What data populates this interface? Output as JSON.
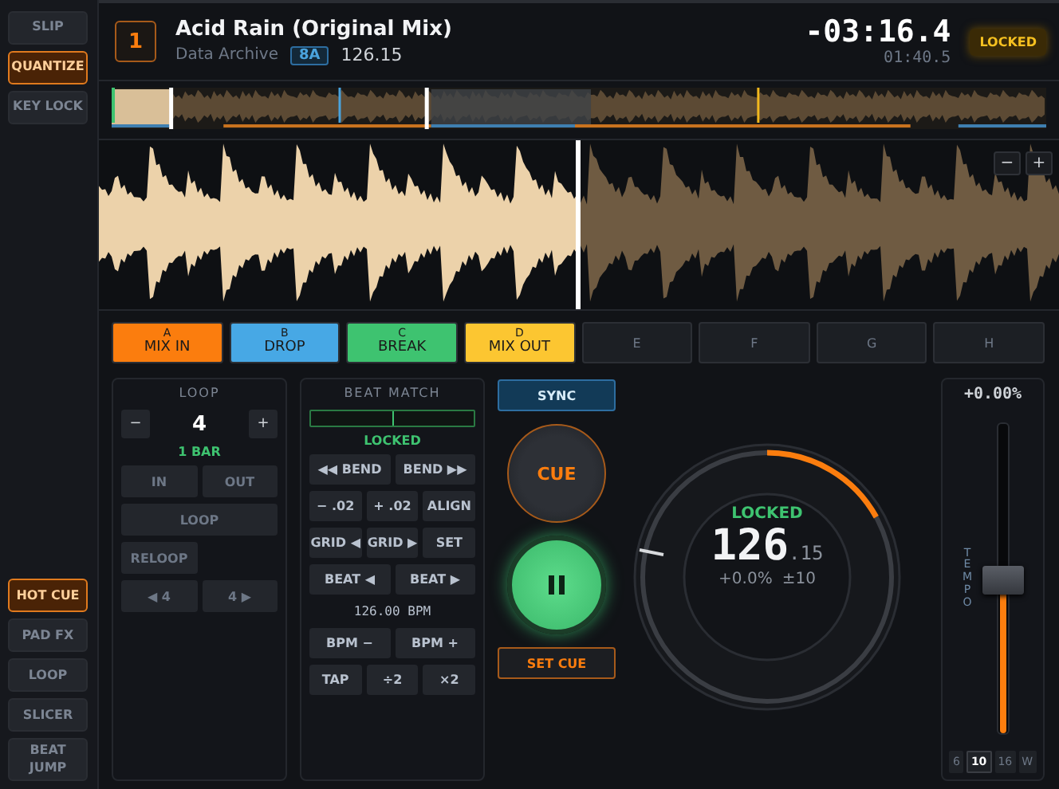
{
  "sidebar": {
    "top_buttons": [
      {
        "label": "SLIP",
        "on": false
      },
      {
        "label": "QUANTIZE",
        "on": true
      },
      {
        "label": "KEY LOCK",
        "on": false
      }
    ],
    "mode_buttons": [
      {
        "label": "HOT CUE",
        "selected": true
      },
      {
        "label": "PAD FX",
        "selected": false
      },
      {
        "label": "LOOP",
        "selected": false
      },
      {
        "label": "SLICER",
        "selected": false
      },
      {
        "label": "BEAT JUMP",
        "selected": false
      }
    ]
  },
  "deck": {
    "number": "1",
    "title": "Acid Rain (Original Mix)",
    "artist": "Data Archive",
    "key": "8A",
    "bpm": "126.15",
    "remaining": "-03:16.4",
    "elapsed": "01:40.5",
    "sync_badge": "LOCKED"
  },
  "waveform": {
    "zoom_buttons": [
      "−",
      "+"
    ]
  },
  "hot_cues": [
    {
      "letter": "A",
      "label": "MIX IN",
      "color": "#fb7d0e"
    },
    {
      "letter": "B",
      "label": "DROP",
      "color": "#47a8e5"
    },
    {
      "letter": "C",
      "label": "BREAK",
      "color": "#3ec370"
    },
    {
      "letter": "D",
      "label": "MIX OUT",
      "color": "#fcc631"
    },
    {
      "letter": "E"
    },
    {
      "letter": "F"
    },
    {
      "letter": "G"
    },
    {
      "letter": "H"
    }
  ],
  "loop": {
    "title": "LOOP",
    "minus": "−",
    "size": "4",
    "plus": "+",
    "length": "1 BAR",
    "in": "IN",
    "out": "OUT",
    "loop": "LOOP",
    "reloop": "RELOOP",
    "back": "◀ 4",
    "forward": "4 ▶"
  },
  "beat_match": {
    "title": "BEAT MATCH",
    "level": 0.5,
    "status": "LOCKED",
    "rows": [
      [
        "◀◀ BEND",
        "BEND ▶▶"
      ],
      [
        "− .02",
        "+ .02",
        "ALIGN"
      ],
      [
        "GRID ◀",
        "GRID ▶",
        "SET"
      ],
      [
        "BEAT ◀",
        "BEAT ▶"
      ]
    ],
    "bpm_readout": "126.00 BPM",
    "rows2": [
      [
        "BPM −",
        "BPM +"
      ],
      [
        "TAP",
        "÷2",
        "×2"
      ]
    ]
  },
  "transport": {
    "sync": "SYNC",
    "cue": "CUE",
    "playing": true,
    "set_cue": "SET CUE"
  },
  "jog": {
    "status": "LOCKED",
    "bpm_whole": "126",
    "bpm_fraction": ".15",
    "pitch": "+0.0%",
    "range": "±10"
  },
  "tempo": {
    "readout": "+0.00%",
    "label": "TEMPO",
    "level": 0.5,
    "ranges": [
      {
        "label": "6",
        "selected": false
      },
      {
        "label": "10",
        "selected": true
      },
      {
        "label": "16",
        "selected": false
      },
      {
        "label": "W",
        "selected": false
      }
    ]
  }
}
